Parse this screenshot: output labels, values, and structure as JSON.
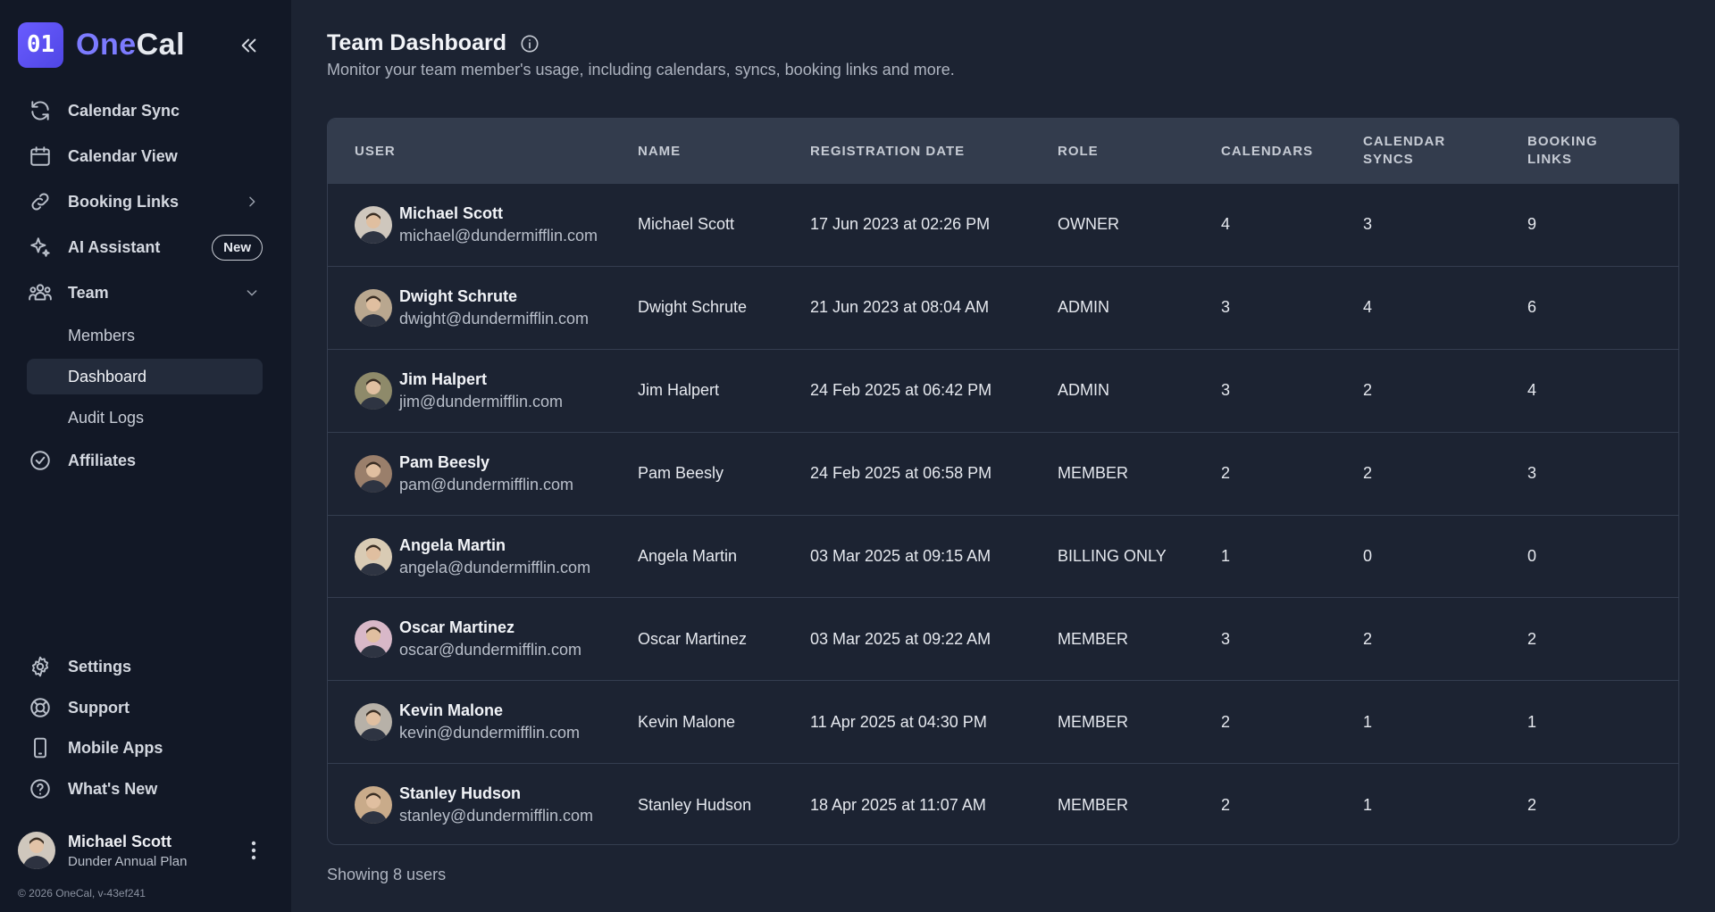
{
  "app": {
    "logo_text": "01",
    "brand_one": "One",
    "brand_cal": "Cal"
  },
  "nav": {
    "calendar_sync": "Calendar Sync",
    "calendar_view": "Calendar View",
    "booking_links": "Booking Links",
    "ai_assistant": "AI Assistant",
    "ai_badge": "New",
    "team": "Team",
    "team_members": "Members",
    "team_dashboard": "Dashboard",
    "team_audit": "Audit Logs",
    "affiliates": "Affiliates",
    "settings": "Settings",
    "support": "Support",
    "mobile_apps": "Mobile Apps",
    "whats_new": "What's New"
  },
  "account": {
    "name": "Michael Scott",
    "plan": "Dunder Annual Plan",
    "copyright": "© 2026 OneCal, v-43ef241"
  },
  "page": {
    "title": "Team Dashboard",
    "subtitle": "Monitor your team member's usage, including calendars, syncs, booking links and more.",
    "footer": "Showing 8 users"
  },
  "table": {
    "headers": {
      "user": "USER",
      "name": "NAME",
      "registration_date": "REGISTRATION DATE",
      "role": "ROLE",
      "calendars": "CALENDARS",
      "calendar_syncs_1": "CALENDAR",
      "calendar_syncs_2": "SYNCS",
      "booking_links_1": "BOOKING",
      "booking_links_2": "LINKS"
    },
    "rows": [
      {
        "user": "Michael Scott",
        "email": "michael@dundermifflin.com",
        "name": "Michael Scott",
        "date": "17 Jun 2023 at 02:26 PM",
        "role": "OWNER",
        "calendars": "4",
        "syncs": "3",
        "links": "9",
        "avatar_color": "#cfc7bd"
      },
      {
        "user": "Dwight Schrute",
        "email": "dwight@dundermifflin.com",
        "name": "Dwight Schrute",
        "date": "21 Jun 2023 at 08:04 AM",
        "role": "ADMIN",
        "calendars": "3",
        "syncs": "4",
        "links": "6",
        "avatar_color": "#b9a78f"
      },
      {
        "user": "Jim Halpert",
        "email": "jim@dundermifflin.com",
        "name": "Jim Halpert",
        "date": "24 Feb 2025 at 06:42 PM",
        "role": "ADMIN",
        "calendars": "3",
        "syncs": "2",
        "links": "4",
        "avatar_color": "#8e8a6a"
      },
      {
        "user": "Pam Beesly",
        "email": "pam@dundermifflin.com",
        "name": "Pam Beesly",
        "date": "24 Feb 2025 at 06:58 PM",
        "role": "MEMBER",
        "calendars": "2",
        "syncs": "2",
        "links": "3",
        "avatar_color": "#9a7f6b"
      },
      {
        "user": "Angela Martin",
        "email": "angela@dundermifflin.com",
        "name": "Angela Martin",
        "date": "03 Mar 2025 at 09:15 AM",
        "role": "BILLING ONLY",
        "calendars": "1",
        "syncs": "0",
        "links": "0",
        "avatar_color": "#d9cbb4"
      },
      {
        "user": "Oscar Martinez",
        "email": "oscar@dundermifflin.com",
        "name": "Oscar Martinez",
        "date": "03 Mar 2025 at 09:22 AM",
        "role": "MEMBER",
        "calendars": "3",
        "syncs": "2",
        "links": "2",
        "avatar_color": "#d8b8c8"
      },
      {
        "user": "Kevin Malone",
        "email": "kevin@dundermifflin.com",
        "name": "Kevin Malone",
        "date": "11 Apr 2025 at 04:30 PM",
        "role": "MEMBER",
        "calendars": "2",
        "syncs": "1",
        "links": "1",
        "avatar_color": "#b7b1a8"
      },
      {
        "user": "Stanley Hudson",
        "email": "stanley@dundermifflin.com",
        "name": "Stanley Hudson",
        "date": "18 Apr 2025 at 11:07 AM",
        "role": "MEMBER",
        "calendars": "2",
        "syncs": "1",
        "links": "2",
        "avatar_color": "#c9ab8a"
      }
    ]
  }
}
